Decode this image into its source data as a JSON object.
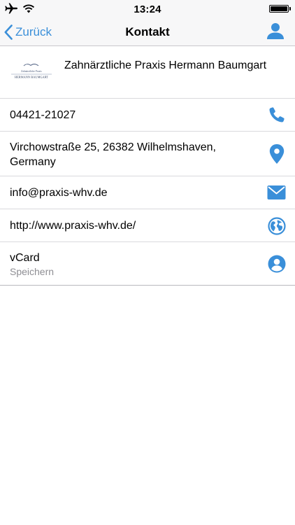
{
  "status_bar": {
    "time": "13:24",
    "battery_level": 1.0,
    "icons": [
      "airplane-icon",
      "wifi-icon",
      "battery-icon"
    ]
  },
  "nav": {
    "back_label": "Zurück",
    "title": "Kontakt",
    "right_icon": "person-icon"
  },
  "header": {
    "logo_text_top": "Zahnärztliche Praxis",
    "logo_text_bottom": "HERMANN BAUMGART",
    "name": "Zahnärztliche Praxis Hermann Baumgart"
  },
  "contact": {
    "phone": "04421-21027",
    "address": "Virchowstraße 25, 26382 Wilhelmshaven, Germany",
    "email": "info@praxis-whv.de",
    "website": "http://www.praxis-whv.de/",
    "vcard_label": "vCard",
    "vcard_sublabel": "Speichern"
  },
  "colors": {
    "accent": "#3a8fd9",
    "separator": "#d9d9dd",
    "secondary_text": "#8e8e93"
  }
}
